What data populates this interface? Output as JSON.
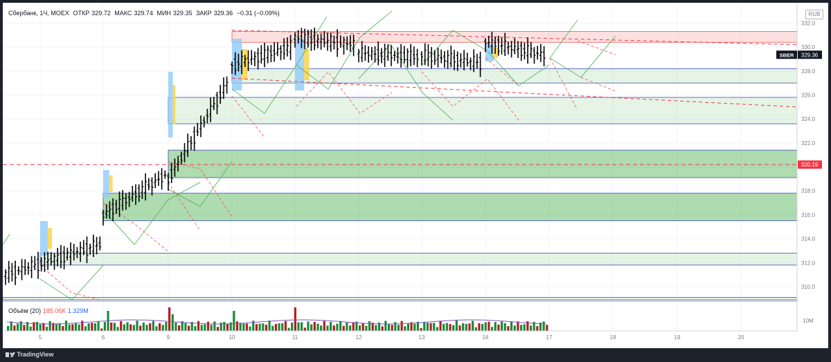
{
  "legend": {
    "title": "Сбербанк, 1Ч, MOEX",
    "open_label": "ОТКР",
    "open": "329.72",
    "high_label": "МАКС",
    "high": "329.74",
    "low_label": "МИН",
    "low": "329.35",
    "close_label": "ЗАКР",
    "close": "329.36",
    "change": "−0.31 (−0.09%)"
  },
  "currency": "RUB",
  "price_badge": {
    "ticker": "SBER",
    "price": "329.36"
  },
  "level_badge": {
    "price": "320.19"
  },
  "volume_legend": {
    "label": "Объём (20)",
    "volume": "185.06K",
    "ma": "1.329M"
  },
  "footer": {
    "brand": "TradingView",
    "logo_icon": "tradingview-logo-icon"
  },
  "colors": {
    "up": "#26a69a",
    "down": "#ef5350",
    "candle": "#000000",
    "zone": "#4caf50",
    "projection_green": "#4caf50",
    "projection_red": "#ef5350",
    "level_line": "#f23645",
    "axis_text": "#787b86"
  },
  "chart_data": {
    "type": "ohlc",
    "title": "",
    "xlabel": "",
    "ylabel": "",
    "x_ticks": [
      "5",
      "6",
      "9",
      "10",
      "11",
      "12",
      "13",
      "16",
      "17",
      "18",
      "19",
      "20"
    ],
    "y_ticks": [
      310,
      312,
      314,
      316,
      318,
      320,
      322,
      324,
      326,
      328,
      330,
      332
    ],
    "ylim": [
      308.9,
      333.7
    ],
    "volume_ticks": [
      "10M"
    ],
    "grid": true,
    "last_price": 329.36,
    "horizontal_level": 320.19,
    "series_close_approx": [
      {
        "session": "5",
        "from": 311.0,
        "to": 313.5
      },
      {
        "session": "6",
        "from": 316.0,
        "to": 319.3
      },
      {
        "session": "9",
        "from": 319.0,
        "to": 326.9
      },
      {
        "session": "10",
        "from": 328.5,
        "to": 330.0
      },
      {
        "session": "11",
        "from": 330.8,
        "to": 330.2
      },
      {
        "session": "12",
        "from": 329.5,
        "to": 329.2
      },
      {
        "session": "13",
        "from": 329.3,
        "to": 328.7
      },
      {
        "session": "16",
        "from": 330.4,
        "to": 329.36
      }
    ],
    "zones": [
      {
        "low": 330.4,
        "high": 331.3,
        "kind": "resistance"
      },
      {
        "low": 327.0,
        "high": 328.2,
        "kind": "demand"
      },
      {
        "low": 323.6,
        "high": 325.8,
        "kind": "demand"
      },
      {
        "low": 319.1,
        "high": 321.4,
        "kind": "demand"
      },
      {
        "low": 315.5,
        "high": 317.8,
        "kind": "demand"
      },
      {
        "low": 311.8,
        "high": 312.8,
        "kind": "demand"
      },
      {
        "low": 308.9,
        "high": 309.1,
        "kind": "demand"
      }
    ]
  }
}
